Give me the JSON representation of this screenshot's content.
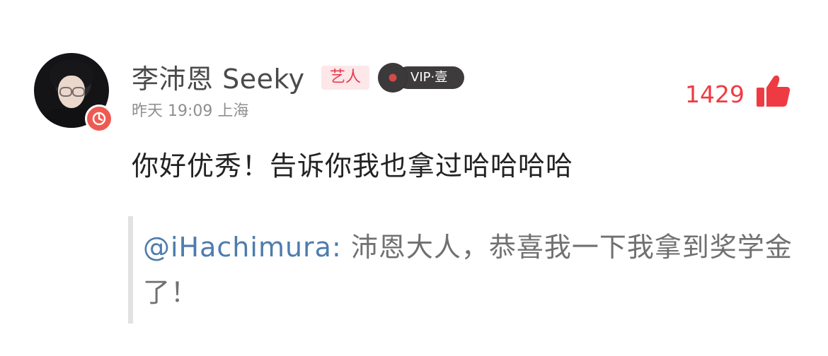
{
  "user": {
    "name": "李沛恩 Seeky",
    "artist_tag": "艺人",
    "vip_label": "VIP·壹"
  },
  "meta": {
    "time": "昨天 19:09",
    "location": "上海"
  },
  "likes": {
    "count": "1429"
  },
  "comment": {
    "text": "你好优秀！告诉你我也拿过哈哈哈哈"
  },
  "quoted": {
    "mention": "@iHachimura:",
    "text": "沛恩大人，恭喜我一下我拿到奖学金了！"
  },
  "icons": {
    "avatar_badge": "music-note-icon",
    "vip": "vinyl-disc-icon",
    "like": "thumbs-up-icon"
  },
  "colors": {
    "accent_red": "#ee3b43",
    "mention_blue": "#4e7cae",
    "artist_tag_bg": "#fde7e8"
  }
}
